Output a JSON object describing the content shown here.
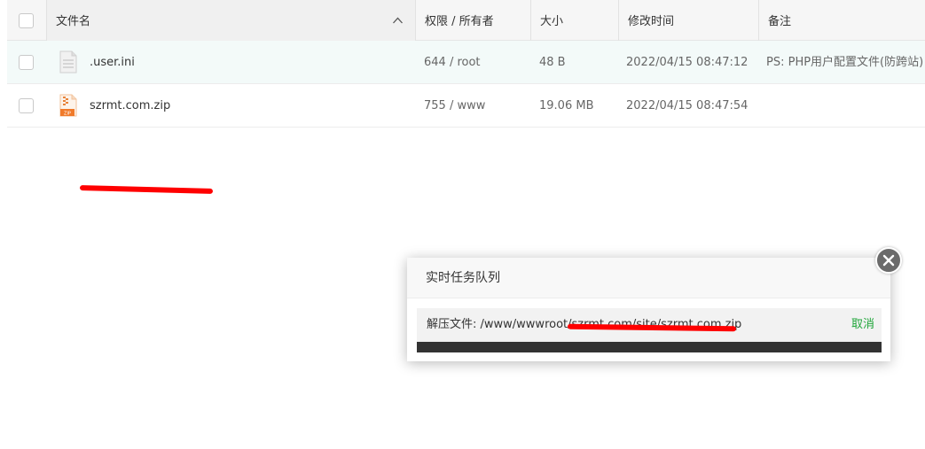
{
  "table": {
    "headers": {
      "name": "文件名",
      "permission": "权限 / 所有者",
      "size": "大小",
      "modified": "修改时间",
      "note": "备注"
    },
    "rows": [
      {
        "name": ".user.ini",
        "icon": "document-icon",
        "permission": "644 / root",
        "size": "48 B",
        "modified": "2022/04/15 08:47:12",
        "note": "PS: PHP用户配置文件(防跨站)!"
      },
      {
        "name": "szrmt.com.zip",
        "icon": "zip-file-icon",
        "permission": "755 / www",
        "size": "19.06 MB",
        "modified": "2022/04/15 08:47:54",
        "note": ""
      }
    ]
  },
  "task_dialog": {
    "title": "实时任务队列",
    "task_text": "解压文件: /www/wwwroot/szrmt.com/site/szrmt.com.zip",
    "cancel_label": "取消",
    "progress": 0
  },
  "colors": {
    "accent_green": "#20a53a",
    "redaction": "#ff0000",
    "progress_track": "#333333"
  }
}
